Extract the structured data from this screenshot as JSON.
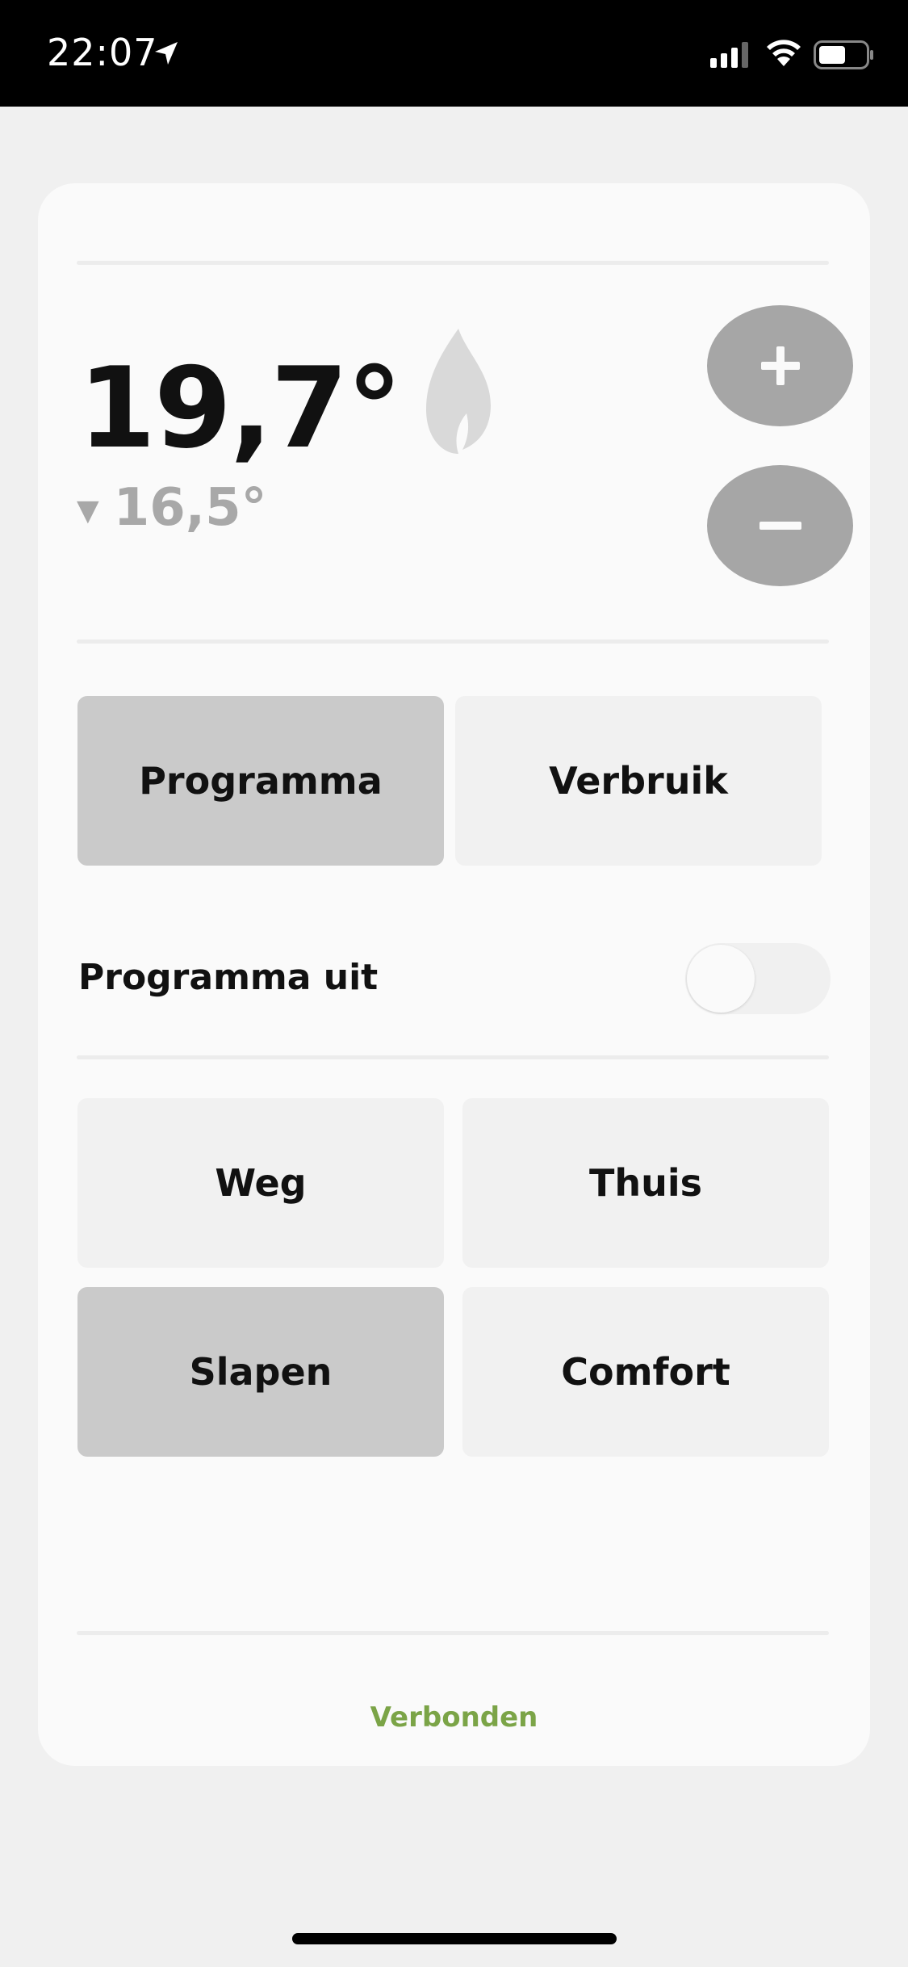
{
  "status_bar": {
    "time": "22:07",
    "icons": [
      "location-arrow-icon",
      "cellular-signal-icon",
      "wifi-icon",
      "battery-icon"
    ]
  },
  "thermostat": {
    "current_temp": "19,7°",
    "setpoint_indicator": "▼",
    "setpoint_temp": "16,5°",
    "heating_icon": "flame-icon",
    "increase_label": "+",
    "decrease_label": "−"
  },
  "tabs": [
    {
      "label": "Programma",
      "active": true
    },
    {
      "label": "Verbruik",
      "active": false
    }
  ],
  "program_toggle": {
    "label": "Programma uit",
    "on": false
  },
  "presets": [
    {
      "label": "Weg",
      "active": false
    },
    {
      "label": "Thuis",
      "active": false
    },
    {
      "label": "Slapen",
      "active": true
    },
    {
      "label": "Comfort",
      "active": false
    }
  ],
  "footer": {
    "status": "Verbonden",
    "status_color": "#7ba447"
  },
  "colors": {
    "active_tile": "#cacaca",
    "inactive_tile": "#f1f1f1",
    "round_button": "#a6a6a6",
    "flame": "#d9d9d9"
  }
}
